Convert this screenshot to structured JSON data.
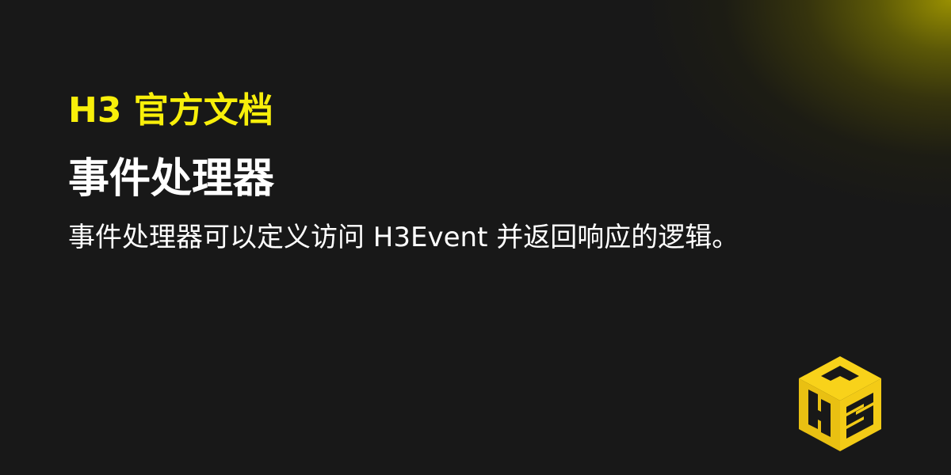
{
  "hero": {
    "eyebrow": "H3 官方文档",
    "title": "事件处理器",
    "subtitle": "事件处理器可以定义访问 H3Event 并返回响应的逻辑。"
  },
  "logo": {
    "icon": "h3-cube-logo-icon",
    "primary_color": "#f8d21a",
    "shade_color": "#c9a50e"
  },
  "background": {
    "base_color": "#181818",
    "glow_color": "#a09600"
  }
}
